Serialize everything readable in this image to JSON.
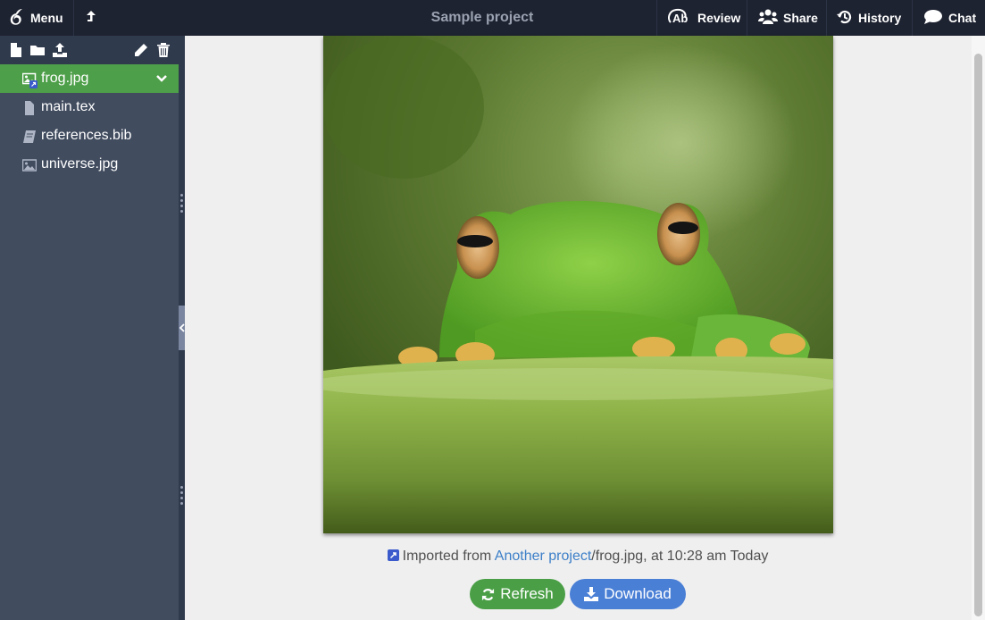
{
  "header": {
    "menu_label": "Menu",
    "title": "Sample project",
    "review_label": "Review",
    "share_label": "Share",
    "history_label": "History",
    "chat_label": "Chat"
  },
  "sidebar": {
    "toolbar": {
      "new_file": "new-file-icon",
      "new_folder": "new-folder-icon",
      "upload": "upload-icon",
      "rename": "pencil-icon",
      "delete": "trash-icon"
    },
    "files": [
      {
        "name": "frog.jpg",
        "type": "linked-image",
        "selected": true
      },
      {
        "name": "main.tex",
        "type": "file"
      },
      {
        "name": "references.bib",
        "type": "book"
      },
      {
        "name": "universe.jpg",
        "type": "image"
      }
    ]
  },
  "main": {
    "image_alt": "frog.jpg",
    "import": {
      "prefix": "Imported from",
      "project_link": "Another project",
      "suffix": "/frog.jpg, at 10:28 am Today"
    },
    "refresh_label": "Refresh",
    "download_label": "Download"
  },
  "colors": {
    "header_bg": "#1e2331",
    "sidebar_bg": "#414c5f",
    "selected_green": "#4e9f49",
    "refresh_green": "#4a9f46",
    "download_blue": "#4a7fd6",
    "link_blue": "#3c7fc8"
  }
}
